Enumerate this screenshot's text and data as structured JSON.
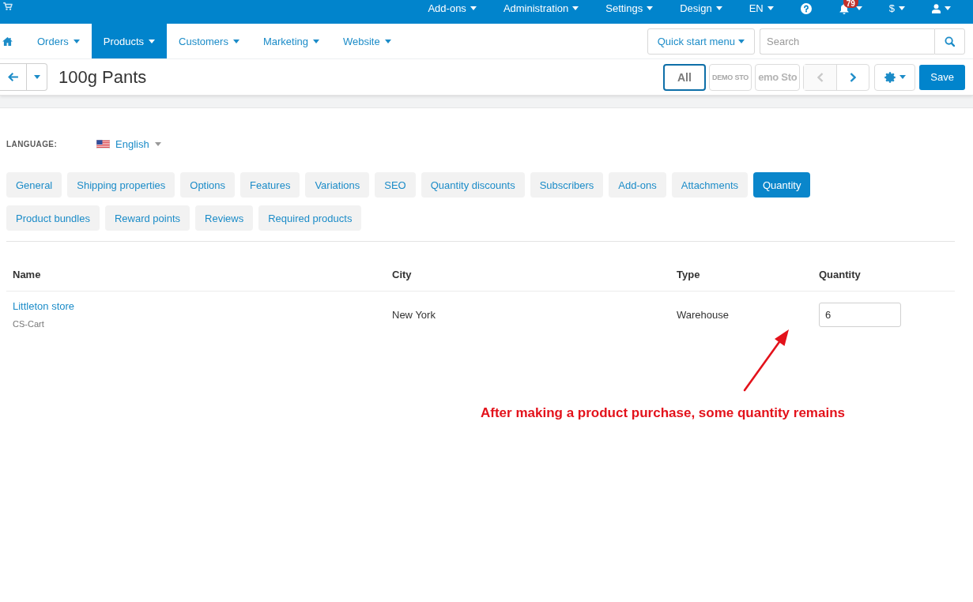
{
  "top_bar": {
    "items": [
      {
        "kind": "menu",
        "label": "Add-ons"
      },
      {
        "kind": "menu",
        "label": "Administration"
      },
      {
        "kind": "menu",
        "label": "Settings"
      },
      {
        "kind": "menu",
        "label": "Design"
      },
      {
        "kind": "menu",
        "label": "EN"
      },
      {
        "kind": "help"
      },
      {
        "kind": "notifications",
        "badge": "79"
      },
      {
        "kind": "menu",
        "label": "$"
      },
      {
        "kind": "user"
      }
    ]
  },
  "nav": {
    "items": [
      {
        "label": "Orders",
        "selected": false
      },
      {
        "label": "Products",
        "selected": true
      },
      {
        "label": "Customers",
        "selected": false
      },
      {
        "label": "Marketing",
        "selected": false
      },
      {
        "label": "Website",
        "selected": false
      }
    ],
    "quick_start": "Quick start menu",
    "search": {
      "placeholder": "Search"
    }
  },
  "toolbar": {
    "title": "100g Pants",
    "stores": [
      {
        "kind": "text",
        "label": "All",
        "selected": true
      },
      {
        "kind": "logo",
        "label": "DEMO STO",
        "selected": false
      },
      {
        "kind": "wordmark",
        "label": "emo Sto",
        "selected": false
      }
    ],
    "pager": [
      {
        "kind": "prev",
        "disabled": true
      },
      {
        "kind": "next",
        "disabled": false
      }
    ],
    "save": "Save"
  },
  "language": {
    "label": "LANGUAGE:",
    "value": "English"
  },
  "tabs": [
    {
      "label": "General",
      "selected": false
    },
    {
      "label": "Shipping properties",
      "selected": false
    },
    {
      "label": "Options",
      "selected": false
    },
    {
      "label": "Features",
      "selected": false
    },
    {
      "label": "Variations",
      "selected": false
    },
    {
      "label": "SEO",
      "selected": false
    },
    {
      "label": "Quantity discounts",
      "selected": false
    },
    {
      "label": "Subscribers",
      "selected": false
    },
    {
      "label": "Add-ons",
      "selected": false
    },
    {
      "label": "Attachments",
      "selected": false
    },
    {
      "label": "Quantity",
      "selected": true
    },
    {
      "label": "Product bundles",
      "selected": false
    },
    {
      "label": "Reward points",
      "selected": false
    },
    {
      "label": "Reviews",
      "selected": false
    },
    {
      "label": "Required products",
      "selected": false
    }
  ],
  "table": {
    "columns": [
      "Name",
      "City",
      "Type",
      "Quantity"
    ],
    "rows": [
      {
        "name": "Littleton store",
        "company": "CS-Cart",
        "city": "New York",
        "type": "Warehouse",
        "quantity": "6"
      }
    ]
  },
  "annotation": {
    "text": "After making a product purchase, some quantity remains"
  }
}
